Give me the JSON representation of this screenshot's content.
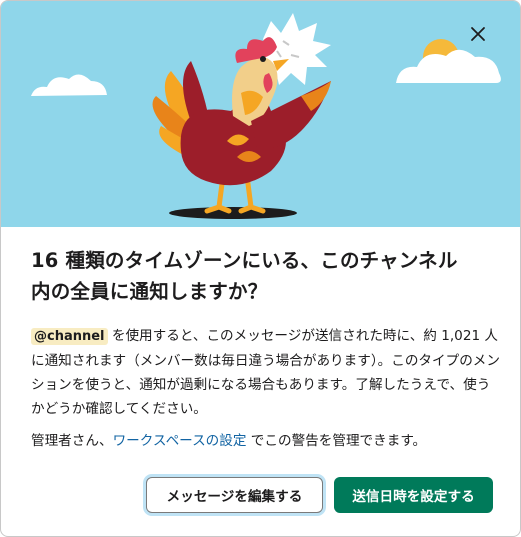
{
  "dialog": {
    "title": "16 種類のタイムゾーンにいる、このチャンネル内の全員に通知しますか？",
    "mention_tag": "@channel",
    "body_text": " を使用すると、このメッセージが送信された時に、約 1,021 人に通知されます（メンバー数は毎日違う場合があります）。このタイプのメンションを使うと、通知が過剰になる場合もあります。了解したうえで、使うかどうか確認してください。",
    "admin_prefix": "管理者さん、",
    "admin_link": "ワークスペースの設定",
    "admin_suffix": " でこの警告を管理できます。"
  },
  "buttons": {
    "edit_label": "メッセージを編集する",
    "schedule_label": "送信日時を設定する"
  },
  "illustration": {
    "subject": "rooster-illustration",
    "sky_color": "#8fd6ea",
    "primary_button_color": "#007a5a"
  },
  "icons": {
    "close": "close-icon"
  }
}
